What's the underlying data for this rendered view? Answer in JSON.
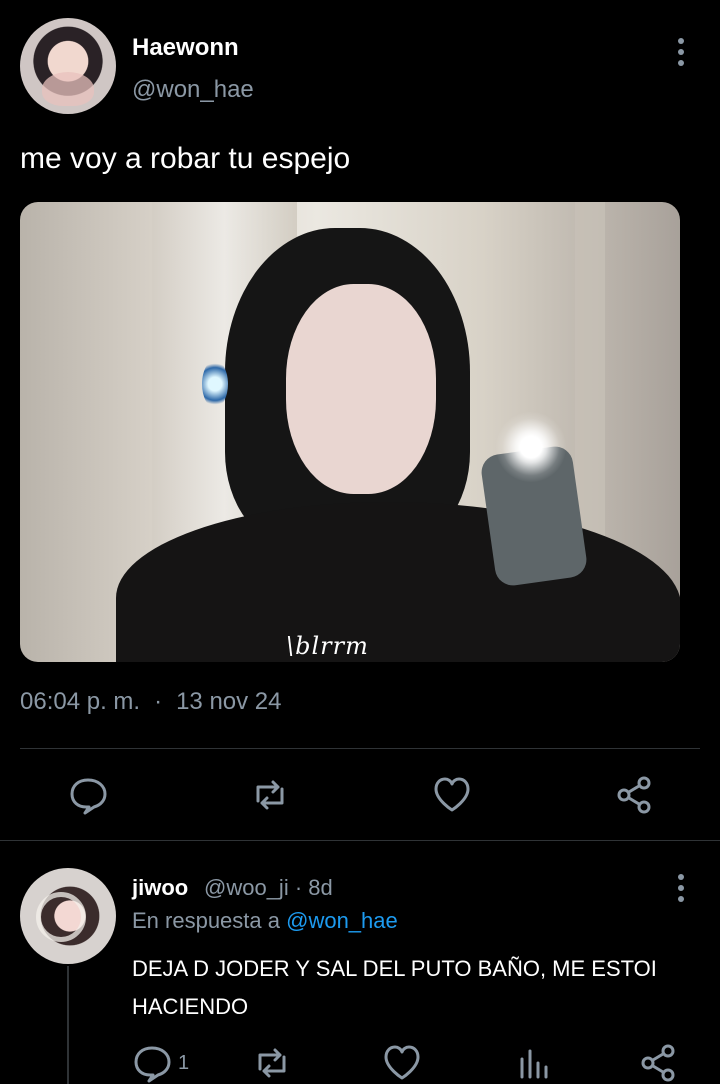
{
  "tweet": {
    "display_name": "Haewonn",
    "handle": "@won_hae",
    "text": "me voy a robar tu espejo",
    "image_text": "\\blrrm",
    "time": "06:04 p. m.",
    "separator": "·",
    "date": "13 nov 24",
    "more_icon": "more-vertical-icon"
  },
  "actions": [
    {
      "name": "reply",
      "icon": "comment-icon"
    },
    {
      "name": "retweet",
      "icon": "repost-icon"
    },
    {
      "name": "like",
      "icon": "heart-icon"
    },
    {
      "name": "share",
      "icon": "share-icon"
    }
  ],
  "reply": {
    "display_name": "jiwoo",
    "handle_and_time": "@woo_ji · 8d",
    "in_reply_to_label": "En respuesta a",
    "in_reply_to_handle": "@won_hae",
    "text": "DEJA D JODER Y SAL DEL PUTO BAÑO, ME ESTOI HACIENDO",
    "reply_count": "1",
    "icons": [
      "comment-icon",
      "repost-icon",
      "heart-icon",
      "bar-chart-icon",
      "share-icon"
    ]
  },
  "colors": {
    "background": "#000000",
    "primary_text": "#e7e9ea",
    "secondary_text": "#8b98a5",
    "link": "#1d9bf0",
    "divider": "#2f3336"
  }
}
